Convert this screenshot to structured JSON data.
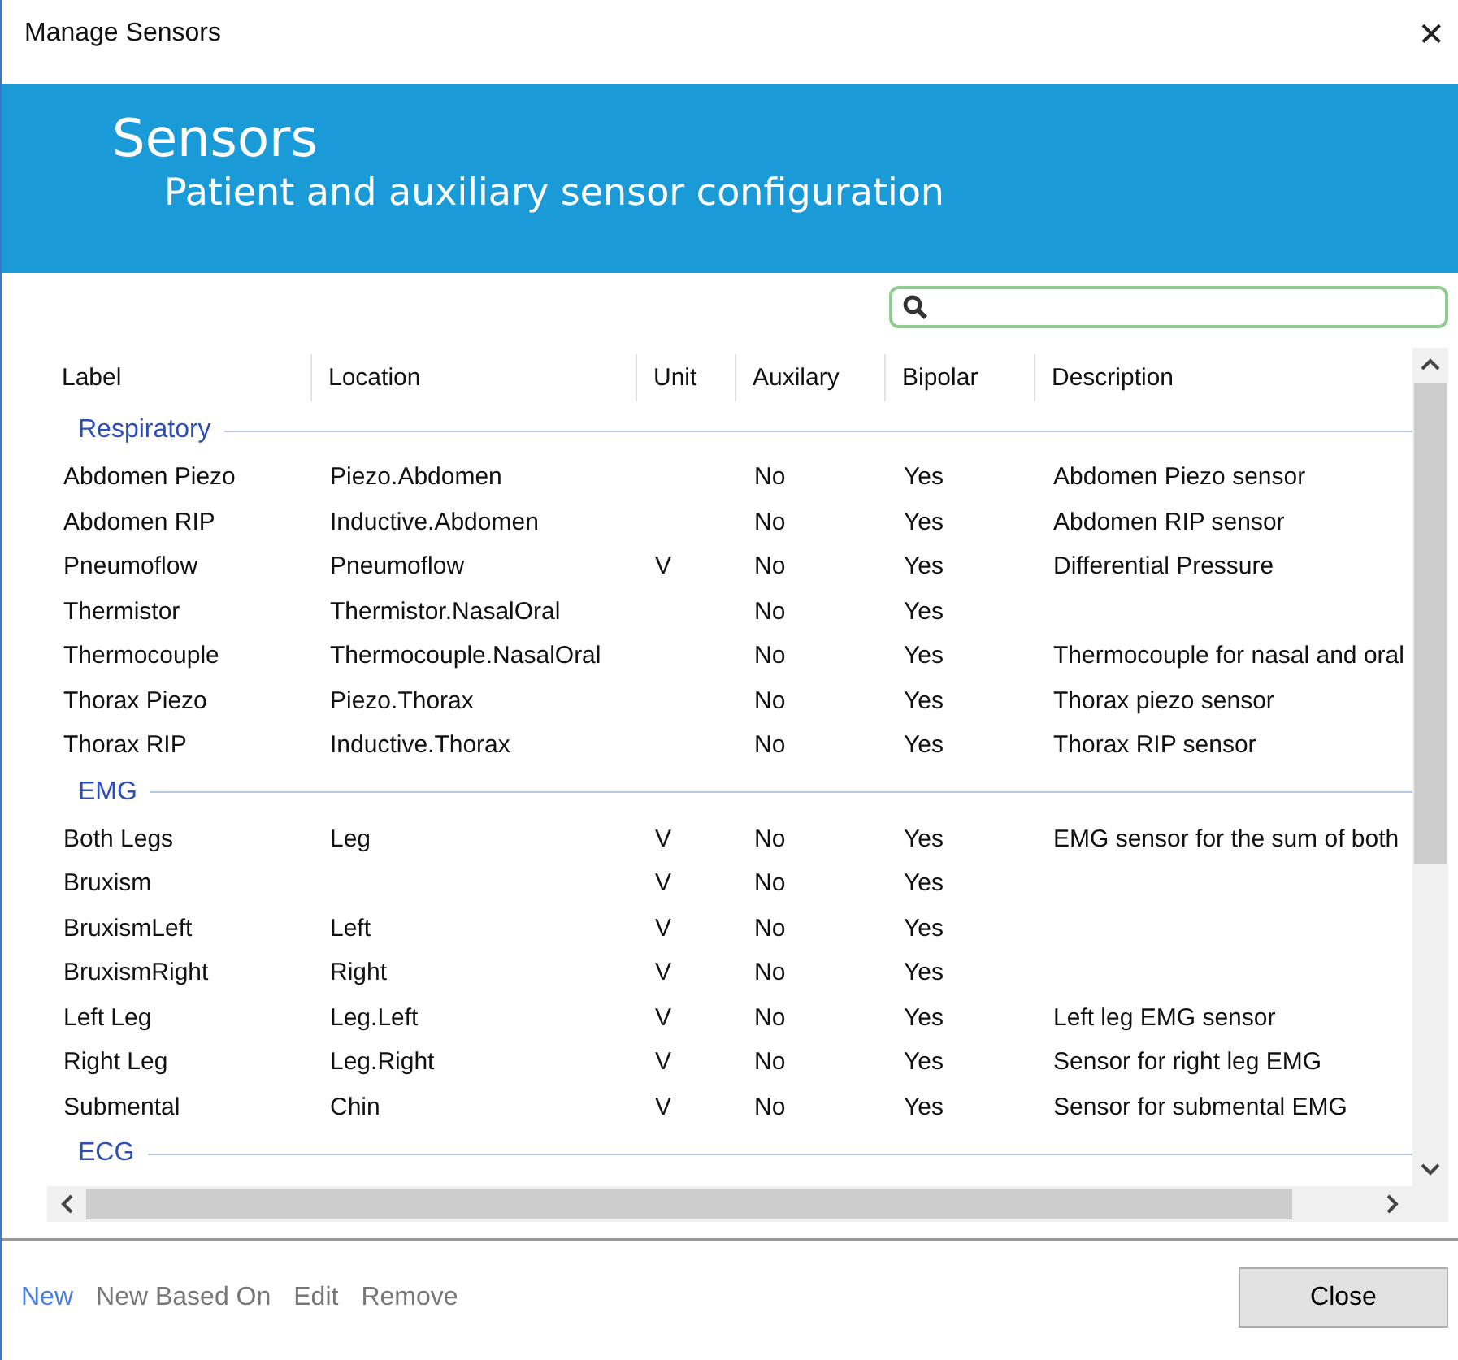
{
  "window": {
    "title": "Manage Sensors",
    "close": "✕"
  },
  "header": {
    "title": "Sensors",
    "subtitle": "Patient and auxiliary sensor configuration"
  },
  "table": {
    "columns": [
      "Label",
      "Location",
      "Unit",
      "Auxilary",
      "Bipolar",
      "Description"
    ],
    "groups": [
      {
        "name": "Respiratory",
        "rows": [
          {
            "label": "Abdomen Piezo",
            "location": "Piezo.Abdomen",
            "auxilary": "No",
            "bipolar": "Yes",
            "description": "Abdomen Piezo sensor"
          },
          {
            "label": "Abdomen RIP",
            "location": "Inductive.Abdomen",
            "auxilary": "No",
            "bipolar": "Yes",
            "description": "Abdomen RIP sensor"
          },
          {
            "label": "Pneumoflow",
            "location": "Pneumoflow",
            "unit": "V",
            "auxilary": "No",
            "bipolar": "Yes",
            "description": "Differential Pressure"
          },
          {
            "label": "Thermistor",
            "location": "Thermistor.NasalOral",
            "auxilary": "No",
            "bipolar": "Yes"
          },
          {
            "label": "Thermocouple",
            "location": "Thermocouple.NasalOral",
            "auxilary": "No",
            "bipolar": "Yes",
            "description": "Thermocouple for nasal and oral"
          },
          {
            "label": "Thorax Piezo",
            "location": "Piezo.Thorax",
            "auxilary": "No",
            "bipolar": "Yes",
            "description": "Thorax piezo sensor"
          },
          {
            "label": "Thorax RIP",
            "location": "Inductive.Thorax",
            "auxilary": "No",
            "bipolar": "Yes",
            "description": "Thorax RIP sensor"
          }
        ]
      },
      {
        "name": "EMG",
        "rows": [
          {
            "label": "Both Legs",
            "location": "Leg",
            "unit": "V",
            "auxilary": "No",
            "bipolar": "Yes",
            "description": "EMG sensor for the sum of both"
          },
          {
            "label": "Bruxism",
            "unit": "V",
            "auxilary": "No",
            "bipolar": "Yes"
          },
          {
            "label": "BruxismLeft",
            "location": "Left",
            "unit": "V",
            "auxilary": "No",
            "bipolar": "Yes"
          },
          {
            "label": "BruxismRight",
            "location": "Right",
            "unit": "V",
            "auxilary": "No",
            "bipolar": "Yes"
          },
          {
            "label": "Left Leg",
            "location": "Leg.Left",
            "unit": "V",
            "auxilary": "No",
            "bipolar": "Yes",
            "description": "Left leg EMG sensor"
          },
          {
            "label": "Right Leg",
            "location": "Leg.Right",
            "unit": "V",
            "auxilary": "No",
            "bipolar": "Yes",
            "description": "Sensor for right leg EMG"
          },
          {
            "label": "Submental",
            "location": "Chin",
            "unit": "V",
            "auxilary": "No",
            "bipolar": "Yes",
            "description": "Sensor for submental EMG"
          }
        ]
      },
      {
        "name": "ECG"
      }
    ]
  },
  "actions": [
    {
      "label": "New",
      "disabled": false
    },
    {
      "label": "New Based On",
      "disabled": true
    },
    {
      "label": "Edit",
      "disabled": true
    },
    {
      "label": "Remove",
      "disabled": true
    }
  ],
  "close_button": "Close"
}
